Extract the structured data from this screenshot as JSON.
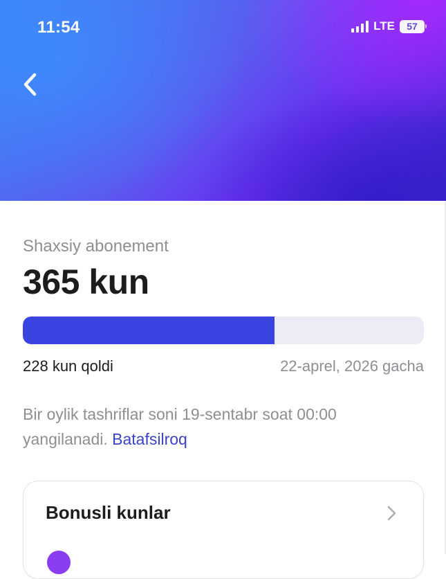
{
  "status_bar": {
    "time": "11:54",
    "network": "LTE",
    "battery": "57"
  },
  "header": {
    "gradient_colors": [
      "#3f86f7",
      "#6a2ff0",
      "#3a22c8"
    ],
    "back_icon": "chevron-left-icon"
  },
  "subscription": {
    "label": "Shaxsiy abonement",
    "days_total": "365 kun",
    "progress_fraction": 0.627,
    "progress_color": "#3a44e0",
    "remaining": "228 kun qoldi",
    "until": "22-aprel, 2026 gacha",
    "info_text": "Bir oylik tashriflar soni 19-sentabr soat 00:00 yangilanadi.",
    "info_link": "Batafsilroq"
  },
  "bonus": {
    "title": "Bonusli kunlar",
    "chevron_icon": "chevron-right-icon"
  }
}
